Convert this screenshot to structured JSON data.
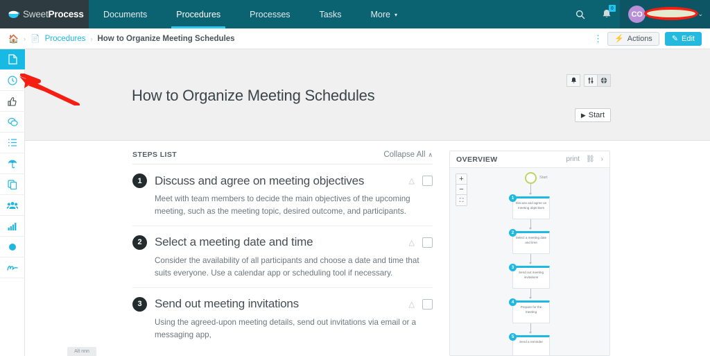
{
  "topnav": {
    "brand": {
      "name_light": "Sweet",
      "name_bold": "Process",
      "icon": "cup-logo-icon"
    },
    "items": [
      {
        "label": "Documents",
        "active": false
      },
      {
        "label": "Procedures",
        "active": true
      },
      {
        "label": "Processes",
        "active": false
      },
      {
        "label": "Tasks",
        "active": false
      },
      {
        "label": "More",
        "active": false,
        "caret": "▾"
      }
    ],
    "search_icon": "search-icon",
    "notifications_icon": "bell-icon",
    "notifications_badge": "0",
    "user": {
      "initials": "CO",
      "name": "",
      "caret": "⌄"
    },
    "bg_color": "#0b6271",
    "brand_bg": "#2e3b40",
    "active_underline": "#2ec9f3"
  },
  "breadcrumb": {
    "home_icon": "home-icon",
    "doc_icon": "document-icon",
    "sep": "›",
    "parent": "Procedures",
    "current": "How to Organize Meeting Schedules",
    "kebab_icon": "more-vertical-icon",
    "actions_label": "Actions",
    "actions_icon": "bolt-icon",
    "edit_label": "Edit",
    "edit_icon": "pencil-square-icon",
    "primary_color": "#24b9de"
  },
  "rail": {
    "items": [
      {
        "name": "documents",
        "icon": "📄",
        "active": true
      },
      {
        "name": "history",
        "icon": "◴",
        "active": false
      },
      {
        "name": "approvals",
        "icon": "👍",
        "active": false
      },
      {
        "name": "comments",
        "icon": "💬",
        "active": false
      },
      {
        "name": "tasks",
        "icon": "☰",
        "active": false
      },
      {
        "name": "knowledge",
        "icon": "☂",
        "active": false
      },
      {
        "name": "copies",
        "icon": "❐",
        "active": false
      },
      {
        "name": "teams",
        "icon": "👥",
        "active": false
      },
      {
        "name": "reports",
        "icon": "▤",
        "active": false
      },
      {
        "name": "status",
        "icon": "●",
        "active": false
      },
      {
        "name": "activity",
        "icon": "∿",
        "active": false
      }
    ],
    "active_bg": "#18b9e3",
    "icon_color": "#1fb6e0"
  },
  "hero": {
    "title": "How to Organize Meeting Schedules",
    "bg_color": "#f0f0f0",
    "icon_buttons": [
      {
        "name": "notify-button",
        "icon": "bell-icon",
        "on": false
      },
      {
        "name": "sort-button",
        "icon": "sliders-icon",
        "on": false
      },
      {
        "name": "globe-button",
        "icon": "globe-icon",
        "on": true
      }
    ],
    "start_label": "Start",
    "start_icon": "play-icon"
  },
  "steps_panel": {
    "header_label": "STEPS LIST",
    "collapse_all_label": "Collapse All",
    "collapse_caret": "∧",
    "steps": [
      {
        "number": "1",
        "title": "Discuss and agree on meeting objectives",
        "body": "Meet with team members to decide the main objectives of the upcoming meeting, such as the meeting topic, desired outcome, and participants."
      },
      {
        "number": "2",
        "title": "Select a meeting date and time",
        "body": "Consider the availability of all participants and choose a date and time that suits everyone. Use a calendar app or scheduling tool if necessary."
      },
      {
        "number": "3",
        "title": "Send out meeting invitations",
        "body": "Using the agreed-upon meeting details, send out invitations via email or a messaging app,"
      }
    ]
  },
  "overview_panel": {
    "title": "OVERVIEW",
    "print_label": "print",
    "expand_icon": "expand-arrows-icon",
    "next_icon": "chevron-right-icon",
    "zoom_in": "+",
    "zoom_out": "−",
    "fit_icon": "fit-screen-icon",
    "flowchart": {
      "start_label": "Start",
      "nodes": [
        {
          "number": "1",
          "label": "Discuss and agree on meeting objectives"
        },
        {
          "number": "2",
          "label": "Select a meeting date and time"
        },
        {
          "number": "3",
          "label": "Send out meeting invitations"
        },
        {
          "number": "4",
          "label": "Prepare for the meeting"
        },
        {
          "number": "5",
          "label": "Send a reminder"
        }
      ],
      "accent_color": "#1eb9e3",
      "start_ring_color": "#b8d663"
    }
  },
  "floating_chip": {
    "label": "Alt nnn"
  },
  "annotations": {
    "oval_color": "#f41f12",
    "arrow_color": "#f41f12"
  }
}
